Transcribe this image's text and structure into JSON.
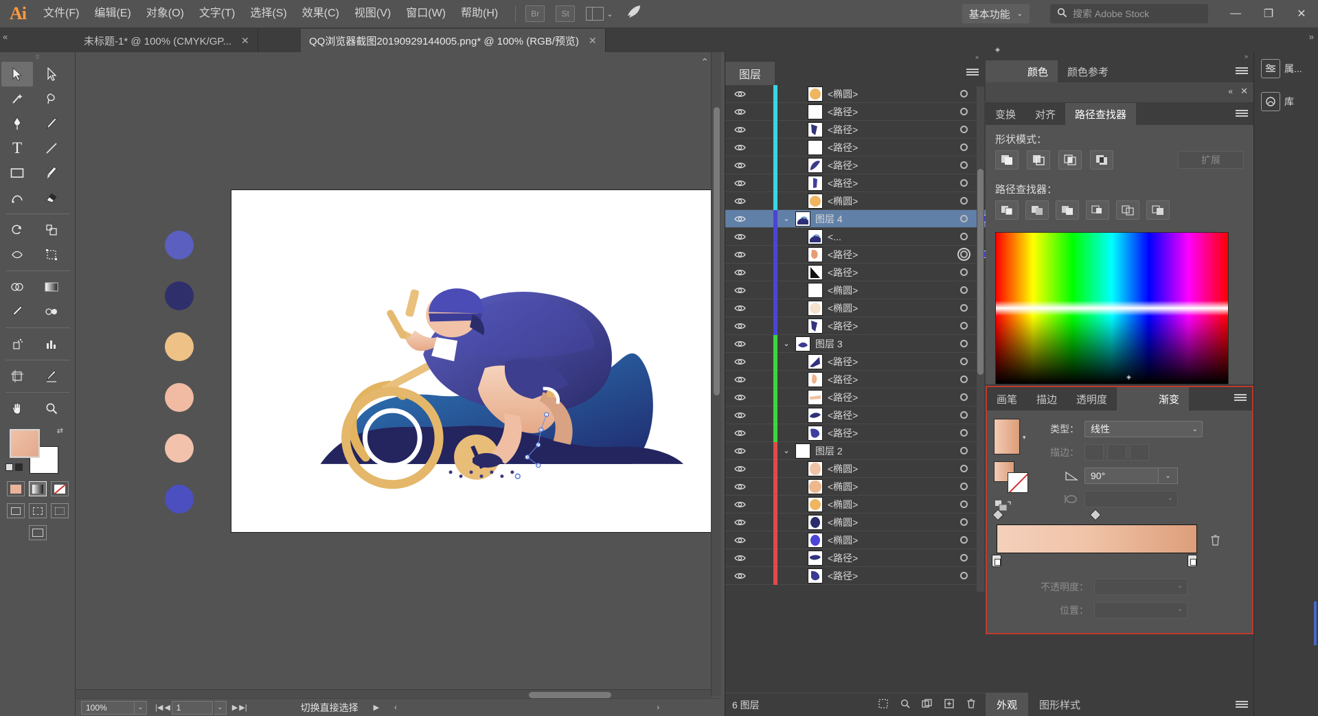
{
  "app": {
    "name": "Adobe Illustrator",
    "logo_text": "Ai"
  },
  "menubar": {
    "items": [
      {
        "label": "文件(F)"
      },
      {
        "label": "编辑(E)"
      },
      {
        "label": "对象(O)"
      },
      {
        "label": "文字(T)"
      },
      {
        "label": "选择(S)"
      },
      {
        "label": "效果(C)"
      },
      {
        "label": "视图(V)"
      },
      {
        "label": "窗口(W)"
      },
      {
        "label": "帮助(H)"
      }
    ],
    "bridge_button": "Br",
    "stock_button": "St",
    "arrange_chevron": "⌄",
    "workspace": "基本功能",
    "workspace_chevron": "⌄",
    "search_placeholder": "搜索 Adobe Stock",
    "search_icon": "⌕",
    "window_minimize": "—",
    "window_restore": "❐",
    "window_close": "✕"
  },
  "tabs": [
    {
      "title": "未标题-1* @ 100% (CMYK/GP...",
      "close": "✕",
      "active": false
    },
    {
      "title": "QQ浏览器截图20190929144005.png* @ 100% (RGB/预览)",
      "close": "✕",
      "active": true
    }
  ],
  "toolbar": {
    "grip": "⁞⁞",
    "tools": [
      {
        "name": "selection-tool",
        "glyph": "➤",
        "selected": true
      },
      {
        "name": "direct-selection-tool",
        "glyph": "➢",
        "selected": false
      },
      {
        "name": "magic-wand-tool",
        "glyph": "✧",
        "selected": false
      },
      {
        "name": "lasso-tool",
        "glyph": "◠",
        "selected": false
      },
      {
        "name": "pen-tool",
        "glyph": "✒",
        "selected": false
      },
      {
        "name": "curvature-tool",
        "glyph": "✎",
        "selected": false
      },
      {
        "name": "type-tool",
        "glyph": "T",
        "selected": false
      },
      {
        "name": "line-segment-tool",
        "glyph": "╱",
        "selected": false
      },
      {
        "name": "rectangle-tool",
        "glyph": "▭",
        "selected": false
      },
      {
        "name": "paintbrush-tool",
        "glyph": "🖌",
        "selected": false
      },
      {
        "name": "shaper-tool",
        "glyph": "◜",
        "selected": false
      },
      {
        "name": "eraser-tool",
        "glyph": "◣",
        "selected": false
      },
      {
        "name": "rotate-tool",
        "glyph": "↻",
        "selected": false
      },
      {
        "name": "scale-tool",
        "glyph": "⤢",
        "selected": false
      },
      {
        "name": "width-tool",
        "glyph": "⟡",
        "selected": false
      },
      {
        "name": "free-transform-tool",
        "glyph": "⬚",
        "selected": false
      },
      {
        "name": "shape-builder-tool",
        "glyph": "⬒",
        "selected": false
      },
      {
        "name": "gradient-tool",
        "glyph": "▬",
        "selected": false
      },
      {
        "name": "eyedropper-tool",
        "glyph": "⟁",
        "selected": false
      },
      {
        "name": "blend-tool",
        "glyph": "⬭",
        "selected": false
      },
      {
        "name": "symbol-sprayer-tool",
        "glyph": "⁂",
        "selected": false
      },
      {
        "name": "column-graph-tool",
        "glyph": "▥",
        "selected": false
      },
      {
        "name": "artboard-tool",
        "glyph": "⌗",
        "selected": false
      },
      {
        "name": "slice-tool",
        "glyph": "✂",
        "selected": false
      },
      {
        "name": "hand-tool",
        "glyph": "✋",
        "selected": false
      },
      {
        "name": "zoom-tool",
        "glyph": "⌕",
        "selected": false
      }
    ],
    "fill_color": "#eab49a",
    "stroke_color": "#ffffff",
    "swap_icon": "⇄",
    "default_icon": "▣"
  },
  "canvas": {
    "artboard_background": "#ffffff",
    "swatch_dots": [
      {
        "color": "#5a5fc0"
      },
      {
        "color": "#2e2f6b"
      },
      {
        "color": "#eec187"
      },
      {
        "color": "#f0bba2"
      },
      {
        "color": "#f2c2ac"
      },
      {
        "color": "#4b4fc0"
      }
    ]
  },
  "statusbar": {
    "zoom_value": "100%",
    "zoom_chevron": "⌄",
    "first_icon": "|◀",
    "prev_icon": "◀",
    "page_value": "1",
    "page_chevron": "⌄",
    "next_icon": "▶",
    "last_icon": "▶|",
    "status_text": "切换直接选择",
    "play_icon": "▶",
    "left_arrow": "‹",
    "right_arrow": "›"
  },
  "layers_panel": {
    "tab_label": "图层",
    "menu_icon": "hamburger-icon",
    "footer_count": "6 图层",
    "footer_icons": [
      "make-clipping-mask-icon",
      "create-new-sublayer-icon",
      "locate-object-icon",
      "create-new-layer-icon",
      "delete-selection-icon"
    ],
    "rows": [
      {
        "name": "<椭圆>",
        "color": "#3ad6e0",
        "indent": 2,
        "thumb": "ellipse-orange",
        "selected": false,
        "twisty": "",
        "target_double": false,
        "has_selection_square": false
      },
      {
        "name": "<路径>",
        "color": "#3ad6e0",
        "indent": 2,
        "thumb": "blank",
        "selected": false,
        "twisty": "",
        "target_double": false,
        "has_selection_square": false
      },
      {
        "name": "<路径>",
        "color": "#3ad6e0",
        "indent": 2,
        "thumb": "shape-navy-a",
        "selected": false,
        "twisty": "",
        "target_double": false,
        "has_selection_square": false
      },
      {
        "name": "<路径>",
        "color": "#3ad6e0",
        "indent": 2,
        "thumb": "blank",
        "selected": false,
        "twisty": "",
        "target_double": false,
        "has_selection_square": false
      },
      {
        "name": "<路径>",
        "color": "#3ad6e0",
        "indent": 2,
        "thumb": "shape-navy-b",
        "selected": false,
        "twisty": "",
        "target_double": false,
        "has_selection_square": false
      },
      {
        "name": "<路径>",
        "color": "#3ad6e0",
        "indent": 2,
        "thumb": "shape-navy-c",
        "selected": false,
        "twisty": "",
        "target_double": false,
        "has_selection_square": false
      },
      {
        "name": "<椭圆>",
        "color": "#3ad6e0",
        "indent": 2,
        "thumb": "ellipse-orange",
        "selected": false,
        "twisty": "",
        "target_double": false,
        "has_selection_square": false
      },
      {
        "name": "图层 4",
        "color": "#4b45d6",
        "indent": 0,
        "thumb": "layer4-art",
        "selected": true,
        "twisty": "⌄",
        "target_double": false,
        "has_selection_square": true
      },
      {
        "name": "<...",
        "color": "#4b45d6",
        "indent": 2,
        "thumb": "layer4-art",
        "selected": false,
        "twisty": "",
        "target_double": false,
        "has_selection_square": false
      },
      {
        "name": "<路径>",
        "color": "#4b45d6",
        "indent": 2,
        "thumb": "shape-skin",
        "selected": false,
        "twisty": "",
        "target_double": true,
        "has_selection_square": true
      },
      {
        "name": "<路径>",
        "color": "#4b45d6",
        "indent": 2,
        "thumb": "shape-black-tri",
        "selected": false,
        "twisty": "",
        "target_double": false,
        "has_selection_square": false
      },
      {
        "name": "<椭圆>",
        "color": "#4b45d6",
        "indent": 2,
        "thumb": "blank",
        "selected": false,
        "twisty": "",
        "target_double": false,
        "has_selection_square": false
      },
      {
        "name": "<椭圆>",
        "color": "#4b45d6",
        "indent": 2,
        "thumb": "ellipse-cream",
        "selected": false,
        "twisty": "",
        "target_double": false,
        "has_selection_square": false
      },
      {
        "name": "<路径>",
        "color": "#4b45d6",
        "indent": 2,
        "thumb": "shape-navy-a",
        "selected": false,
        "twisty": "",
        "target_double": false,
        "has_selection_square": false
      },
      {
        "name": "图层 3",
        "color": "#3cd63c",
        "indent": 0,
        "thumb": "layer3-art",
        "selected": false,
        "twisty": "⌄",
        "target_double": false,
        "has_selection_square": false
      },
      {
        "name": "<路径>",
        "color": "#3cd63c",
        "indent": 2,
        "thumb": "shape-navy-d",
        "selected": false,
        "twisty": "",
        "target_double": false,
        "has_selection_square": false
      },
      {
        "name": "<路径>",
        "color": "#3cd63c",
        "indent": 2,
        "thumb": "shape-skin2",
        "selected": false,
        "twisty": "",
        "target_double": false,
        "has_selection_square": false
      },
      {
        "name": "<路径>",
        "color": "#3cd63c",
        "indent": 2,
        "thumb": "shape-skin3",
        "selected": false,
        "twisty": "",
        "target_double": false,
        "has_selection_square": false
      },
      {
        "name": "<路径>",
        "color": "#3cd63c",
        "indent": 2,
        "thumb": "shape-navy-e",
        "selected": false,
        "twisty": "",
        "target_double": false,
        "has_selection_square": false
      },
      {
        "name": "<路径>",
        "color": "#3cd63c",
        "indent": 2,
        "thumb": "shape-navy-f",
        "selected": false,
        "twisty": "",
        "target_double": false,
        "has_selection_square": false
      },
      {
        "name": "图层 2",
        "color": "#e04a4a",
        "indent": 0,
        "thumb": "blank",
        "selected": false,
        "twisty": "⌄",
        "target_double": false,
        "has_selection_square": false
      },
      {
        "name": "<椭圆>",
        "color": "#e04a4a",
        "indent": 2,
        "thumb": "ellipse-skin",
        "selected": false,
        "twisty": "",
        "target_double": false,
        "has_selection_square": false
      },
      {
        "name": "<椭圆>",
        "color": "#e04a4a",
        "indent": 2,
        "thumb": "ellipse-skin2",
        "selected": false,
        "twisty": "",
        "target_double": false,
        "has_selection_square": false
      },
      {
        "name": "<椭圆>",
        "color": "#e04a4a",
        "indent": 2,
        "thumb": "ellipse-orange",
        "selected": false,
        "twisty": "",
        "target_double": false,
        "has_selection_square": false
      },
      {
        "name": "<椭圆>",
        "color": "#e04a4a",
        "indent": 2,
        "thumb": "ellipse-navy",
        "selected": false,
        "twisty": "",
        "target_double": false,
        "has_selection_square": false
      },
      {
        "name": "<椭圆>",
        "color": "#e04a4a",
        "indent": 2,
        "thumb": "ellipse-blue",
        "selected": false,
        "twisty": "",
        "target_double": false,
        "has_selection_square": false
      },
      {
        "name": "<路径>",
        "color": "#e04a4a",
        "indent": 2,
        "thumb": "shape-navy-g",
        "selected": false,
        "twisty": "",
        "target_double": false,
        "has_selection_square": false
      },
      {
        "name": "<路径>",
        "color": "#e04a4a",
        "indent": 2,
        "thumb": "shape-navy-h",
        "selected": false,
        "twisty": "",
        "target_double": false,
        "has_selection_square": false
      }
    ]
  },
  "color_panel": {
    "tabs": [
      {
        "label": "颜色",
        "active": true,
        "has_dot": true
      },
      {
        "label": "颜色参考",
        "active": false,
        "has_dot": false
      }
    ],
    "menu_icon": "hamburger-icon"
  },
  "pathfinder_panel": {
    "tabs": [
      {
        "label": "变换",
        "active": false
      },
      {
        "label": "对齐",
        "active": false
      },
      {
        "label": "路径查找器",
        "active": true
      }
    ],
    "collapse_icon": "«",
    "close_icon": "✕",
    "shape_modes_label": "形状模式：",
    "shape_modes": [
      "unite-icon",
      "minus-front-icon",
      "intersect-icon",
      "exclude-icon"
    ],
    "expand_button": "扩展",
    "pathfinders_label": "路径查找器：",
    "pathfinders": [
      "divide-icon",
      "trim-icon",
      "merge-icon",
      "crop-icon",
      "outline-icon",
      "minus-back-icon"
    ]
  },
  "gradient_panel": {
    "tabs": [
      {
        "label": "画笔",
        "active": false,
        "has_dot": false
      },
      {
        "label": "描边",
        "active": false,
        "has_dot": false
      },
      {
        "label": "透明度",
        "active": false,
        "has_dot": false
      },
      {
        "label": "渐变",
        "active": true,
        "has_dot": true
      }
    ],
    "menu_icon": "hamburger-icon",
    "type_label": "类型：",
    "type_value": "线性",
    "stroke_label": "描边：",
    "angle_label": "angle-icon",
    "angle_value": "90°",
    "aspect_label": "aspect-ratio-icon",
    "aspect_value": "",
    "opacity_label": "不透明度：",
    "opacity_value": "",
    "location_label": "位置：",
    "location_value": "",
    "delete_stop_icon": "trash-icon",
    "gradient_start_color": "#f4d0bb",
    "gradient_end_color": "#dd9e7a",
    "highlight_border_color": "#c0392b"
  },
  "bottom_panel": {
    "tabs": [
      {
        "label": "外观",
        "active": true
      },
      {
        "label": "图形样式",
        "active": false
      }
    ],
    "menu_icon": "hamburger-icon"
  },
  "dock": {
    "items": [
      {
        "label": "属...",
        "icon": "properties-icon"
      },
      {
        "label": "库",
        "icon": "libraries-icon"
      }
    ]
  }
}
